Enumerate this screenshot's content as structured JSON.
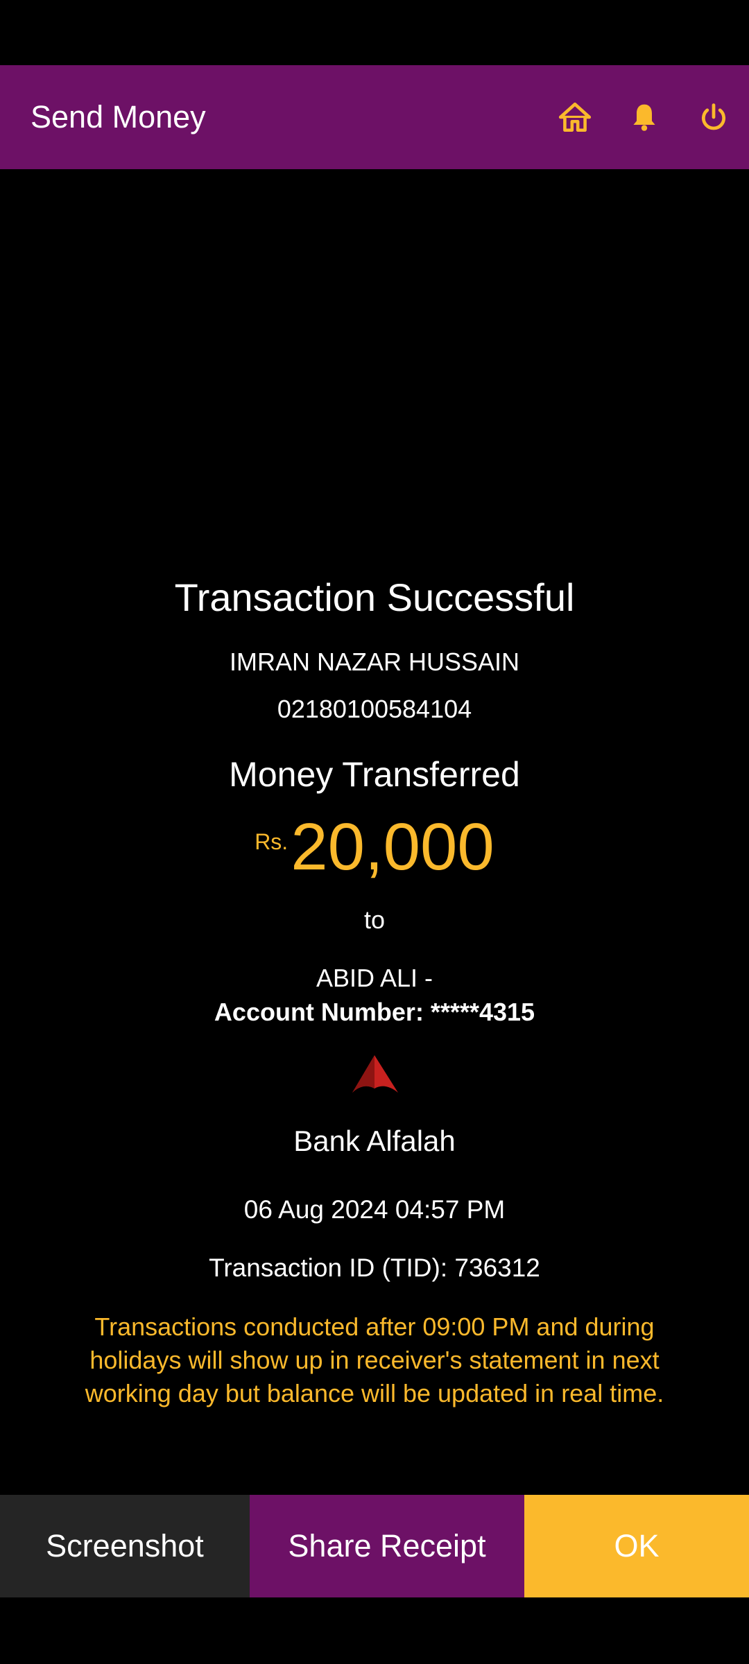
{
  "app_bar": {
    "title": "Send Money",
    "icons": [
      "home-icon",
      "bell-icon",
      "power-icon"
    ],
    "background": "#6d1166",
    "icon_color": "#fbb92c"
  },
  "receipt": {
    "status": "Transaction Successful",
    "sender_name": "IMRAN NAZAR HUSSAIN",
    "sender_account": "02180100584104",
    "money_label": "Money Transferred",
    "currency": "Rs.",
    "amount": "20,000",
    "to_label": "to",
    "receiver_name": "ABID ALI -",
    "receiver_account": "Account Number: *****4315",
    "bank_name": "Bank Alfalah",
    "bank_logo": "bank-alfalah-logo",
    "date_time": "06 Aug 2024 04:57 PM",
    "transaction_id": "Transaction ID (TID): 736312",
    "notice": "Transactions conducted after 09:00 PM and during holidays will show up in receiver's statement in next working day but balance will be updated in real time.",
    "accent_color": "#fbb92c"
  },
  "actions": {
    "screenshot_label": "Screenshot",
    "share_label": "Share Receipt",
    "ok_label": "OK"
  }
}
